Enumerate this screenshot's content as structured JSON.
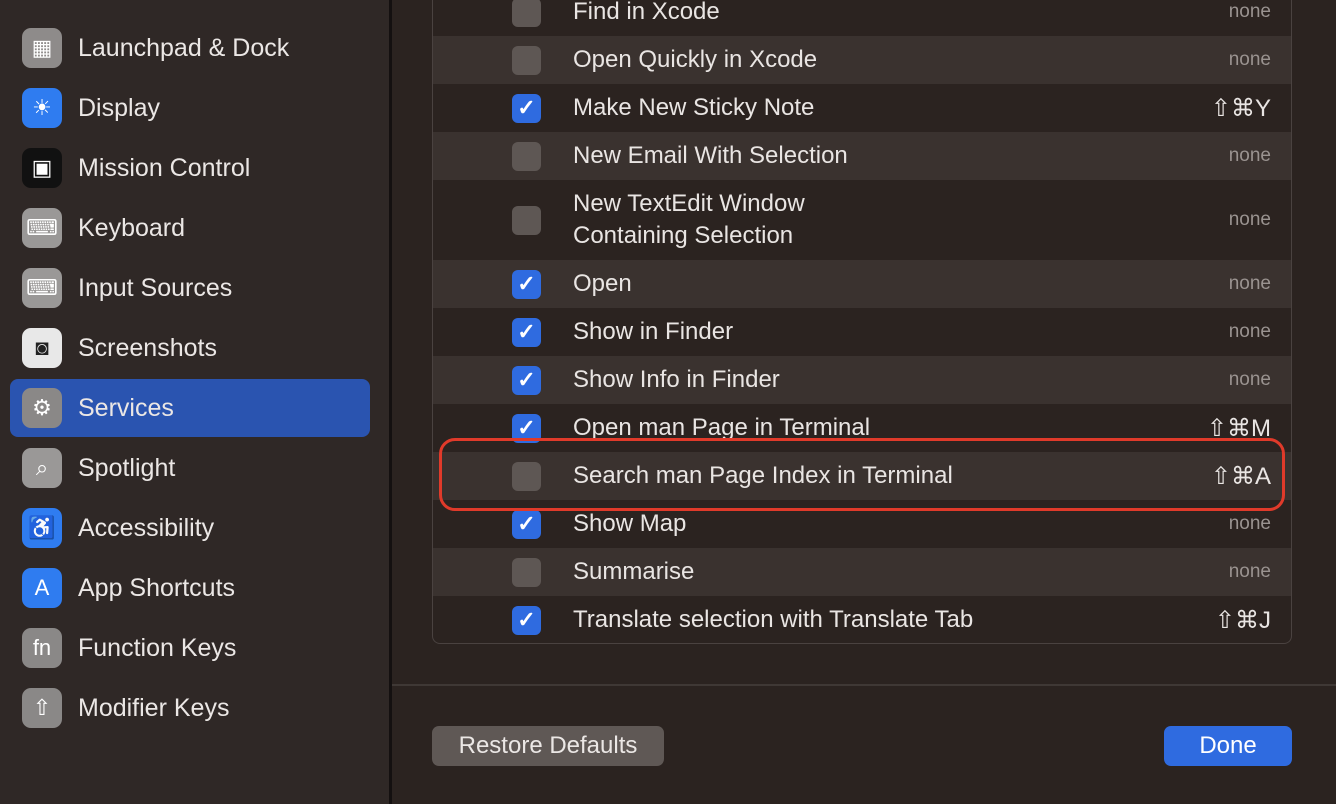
{
  "sidebar": {
    "items": [
      {
        "label": "Launchpad & Dock",
        "icon": "launchpad-icon",
        "selected": false
      },
      {
        "label": "Display",
        "icon": "display-icon",
        "selected": false
      },
      {
        "label": "Mission Control",
        "icon": "mission-control-icon",
        "selected": false
      },
      {
        "label": "Keyboard",
        "icon": "keyboard-icon",
        "selected": false
      },
      {
        "label": "Input Sources",
        "icon": "input-sources-icon",
        "selected": false
      },
      {
        "label": "Screenshots",
        "icon": "screenshots-icon",
        "selected": false
      },
      {
        "label": "Services",
        "icon": "services-gears-icon",
        "selected": true
      },
      {
        "label": "Spotlight",
        "icon": "spotlight-icon",
        "selected": false
      },
      {
        "label": "Accessibility",
        "icon": "accessibility-icon",
        "selected": false
      },
      {
        "label": "App Shortcuts",
        "icon": "app-shortcuts-icon",
        "selected": false
      },
      {
        "label": "Function Keys",
        "icon": "function-keys-icon",
        "selected": false
      },
      {
        "label": "Modifier Keys",
        "icon": "modifier-keys-icon",
        "selected": false
      }
    ]
  },
  "services": [
    {
      "label": "Find in Xcode",
      "checked": false,
      "shortcut": "none"
    },
    {
      "label": "Open Quickly in Xcode",
      "checked": false,
      "shortcut": "none"
    },
    {
      "label": "Make New Sticky Note",
      "checked": true,
      "shortcut": "⇧⌘Y"
    },
    {
      "label": "New Email With Selection",
      "checked": false,
      "shortcut": "none"
    },
    {
      "label": "New TextEdit Window\nContaining Selection",
      "checked": false,
      "shortcut": "none"
    },
    {
      "label": "Open",
      "checked": true,
      "shortcut": "none"
    },
    {
      "label": "Show in Finder",
      "checked": true,
      "shortcut": "none"
    },
    {
      "label": "Show Info in Finder",
      "checked": true,
      "shortcut": "none"
    },
    {
      "label": "Open man Page in Terminal",
      "checked": true,
      "shortcut": "⇧⌘M"
    },
    {
      "label": "Search man Page Index in Terminal",
      "checked": false,
      "shortcut": "⇧⌘A",
      "highlighted": true
    },
    {
      "label": "Show Map",
      "checked": true,
      "shortcut": "none"
    },
    {
      "label": "Summarise",
      "checked": false,
      "shortcut": "none"
    },
    {
      "label": "Translate selection with Translate Tab",
      "checked": true,
      "shortcut": "⇧⌘J"
    }
  ],
  "buttons": {
    "restore": "Restore Defaults",
    "done": "Done"
  },
  "colors": {
    "accent": "#2f6be0",
    "selection": "#2a54b0",
    "highlight": "#e03a2a"
  }
}
